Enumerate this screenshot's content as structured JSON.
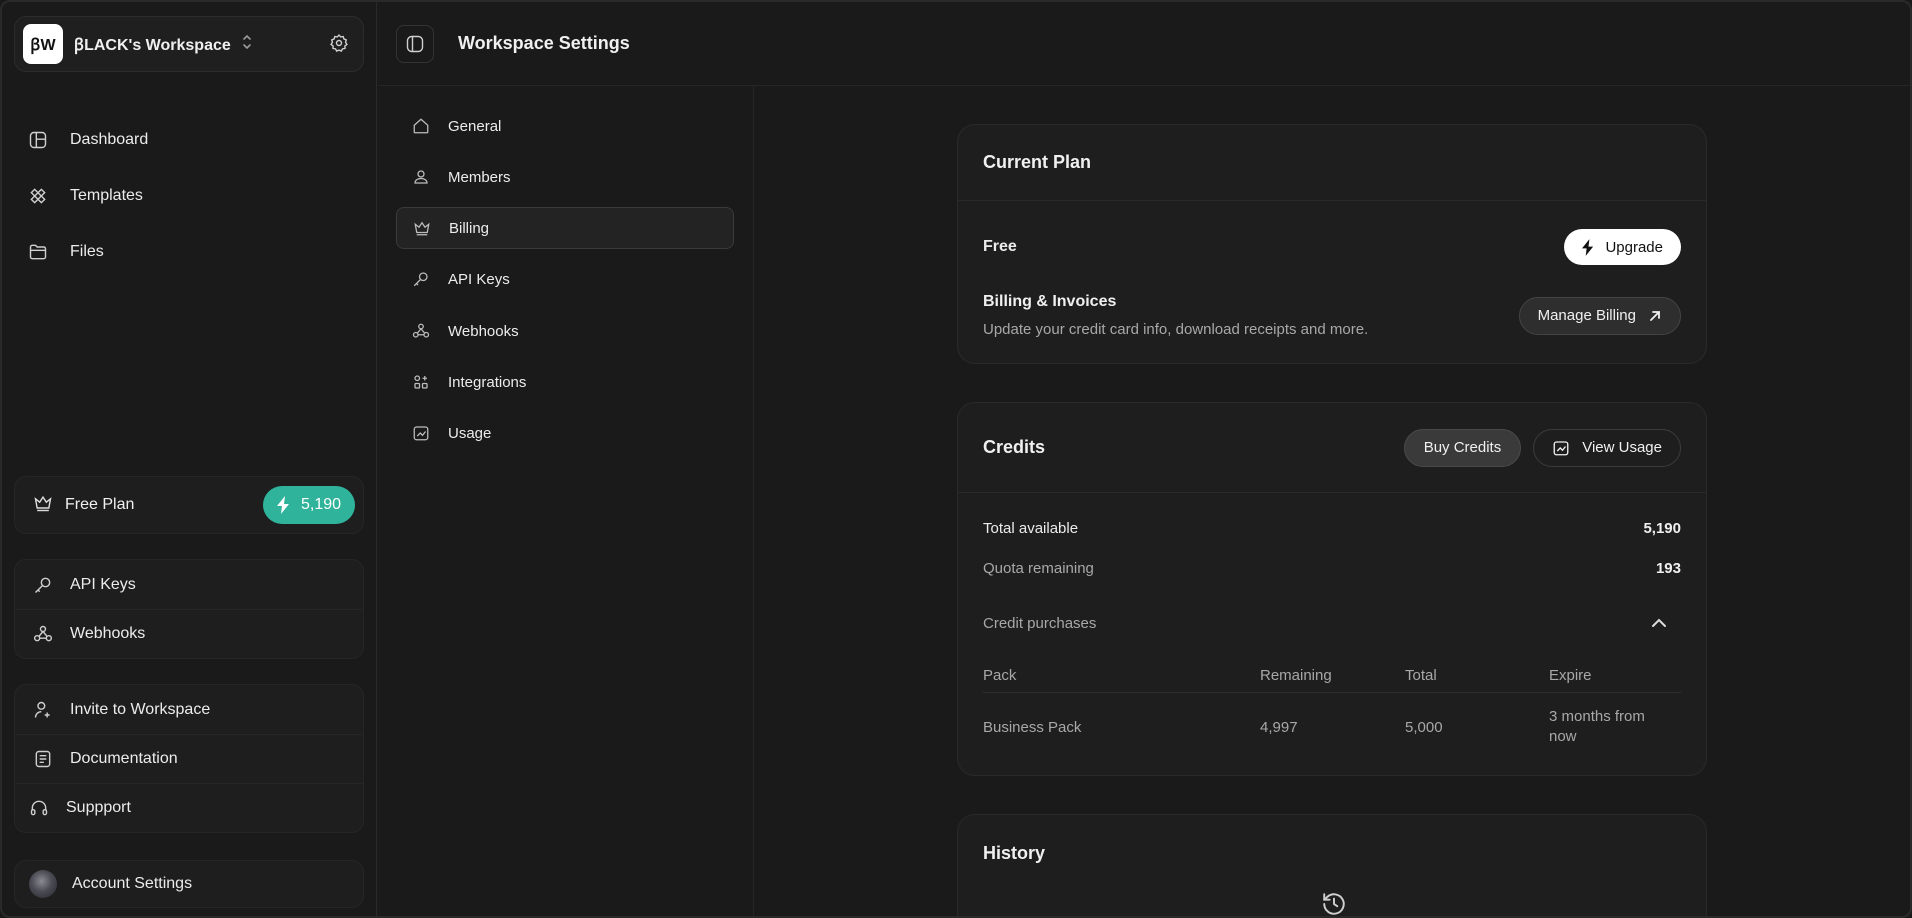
{
  "workspace": {
    "logo_text": "ꞵW",
    "name": "ꞵLACK's Workspace"
  },
  "sidebar": {
    "nav": [
      {
        "label": "Dashboard",
        "icon": "dashboard-icon"
      },
      {
        "label": "Templates",
        "icon": "templates-icon"
      },
      {
        "label": "Files",
        "icon": "folder-icon"
      }
    ],
    "plan": {
      "label": "Free Plan",
      "credits": "5,190"
    },
    "quick_links": [
      {
        "label": "API Keys",
        "icon": "key-icon"
      },
      {
        "label": "Webhooks",
        "icon": "webhook-icon"
      }
    ],
    "help_links": [
      {
        "label": "Invite to Workspace",
        "icon": "user-plus-icon"
      },
      {
        "label": "Documentation",
        "icon": "document-icon"
      },
      {
        "label": "Suppport",
        "icon": "headset-icon"
      }
    ],
    "account": {
      "label": "Account Settings"
    }
  },
  "header": {
    "title": "Workspace Settings"
  },
  "settings_nav": {
    "active": "Billing",
    "items": [
      {
        "label": "General",
        "icon": "home-icon"
      },
      {
        "label": "Members",
        "icon": "members-icon"
      },
      {
        "label": "Billing",
        "icon": "crown-icon"
      },
      {
        "label": "API Keys",
        "icon": "key-icon"
      },
      {
        "label": "Webhooks",
        "icon": "webhook-icon"
      },
      {
        "label": "Integrations",
        "icon": "integrations-icon"
      },
      {
        "label": "Usage",
        "icon": "usage-icon"
      }
    ]
  },
  "current_plan": {
    "title": "Current Plan",
    "plan_name": "Free",
    "upgrade_label": "Upgrade",
    "billing_title": "Billing & Invoices",
    "billing_desc": "Update your credit card info, download receipts and more.",
    "manage_label": "Manage Billing"
  },
  "credits": {
    "title": "Credits",
    "buy_label": "Buy Credits",
    "view_usage_label": "View Usage",
    "total_label": "Total available",
    "total_value": "5,190",
    "quota_label": "Quota remaining",
    "quota_value": "193",
    "purchases_label": "Credit purchases",
    "table": {
      "columns": [
        "Pack",
        "Remaining",
        "Total",
        "Expire"
      ],
      "rows": [
        {
          "pack": "Business Pack",
          "remaining": "4,997",
          "total": "5,000",
          "expire": "3 months from now"
        }
      ]
    }
  },
  "history": {
    "title": "History"
  },
  "colors": {
    "background": "#1a1a1a",
    "accent_teal": "#2fb39a",
    "card": "#1e1e1e"
  }
}
